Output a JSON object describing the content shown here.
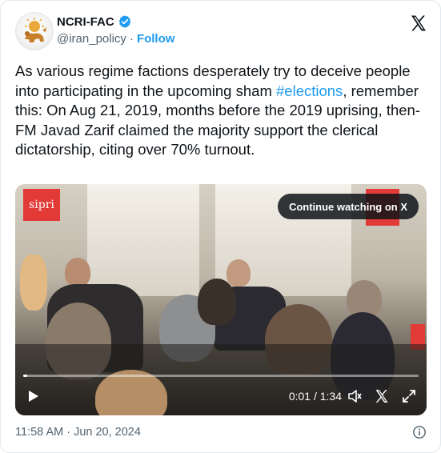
{
  "account": {
    "display_name": "NCRI-FAC",
    "handle": "@iran_policy",
    "separator": "·",
    "follow_label": "Follow"
  },
  "tweet": {
    "text_part1": "As various regime factions desperately try to deceive people into participating in the upcoming sham ",
    "hashtag": "#elections",
    "text_part2": ", remember this: On Aug 21, 2019, months before the 2019 uprising, then-FM Javad Zarif claimed the majority support the clerical dictatorship, citing over 70% turnout."
  },
  "video": {
    "continue_label": "Continue watching on X",
    "watermark": "sipri",
    "time_display": "0:01 / 1:34",
    "progress_fraction": 0.01
  },
  "footer": {
    "timestamp": "11:58 AM · Jun 20, 2024"
  },
  "colors": {
    "accent": "#1d9bf0",
    "text_primary": "#0f1419",
    "text_secondary": "#536471",
    "sipri_red": "#e23a36"
  },
  "icons": {
    "avatar": "lion-and-sun-emblem",
    "verified": "verified-badge-icon",
    "brand": "x-logo-icon",
    "play": "play-icon",
    "volume": "volume-icon",
    "x_small": "x-logo-icon",
    "fullscreen": "fullscreen-icon",
    "info": "info-icon"
  }
}
